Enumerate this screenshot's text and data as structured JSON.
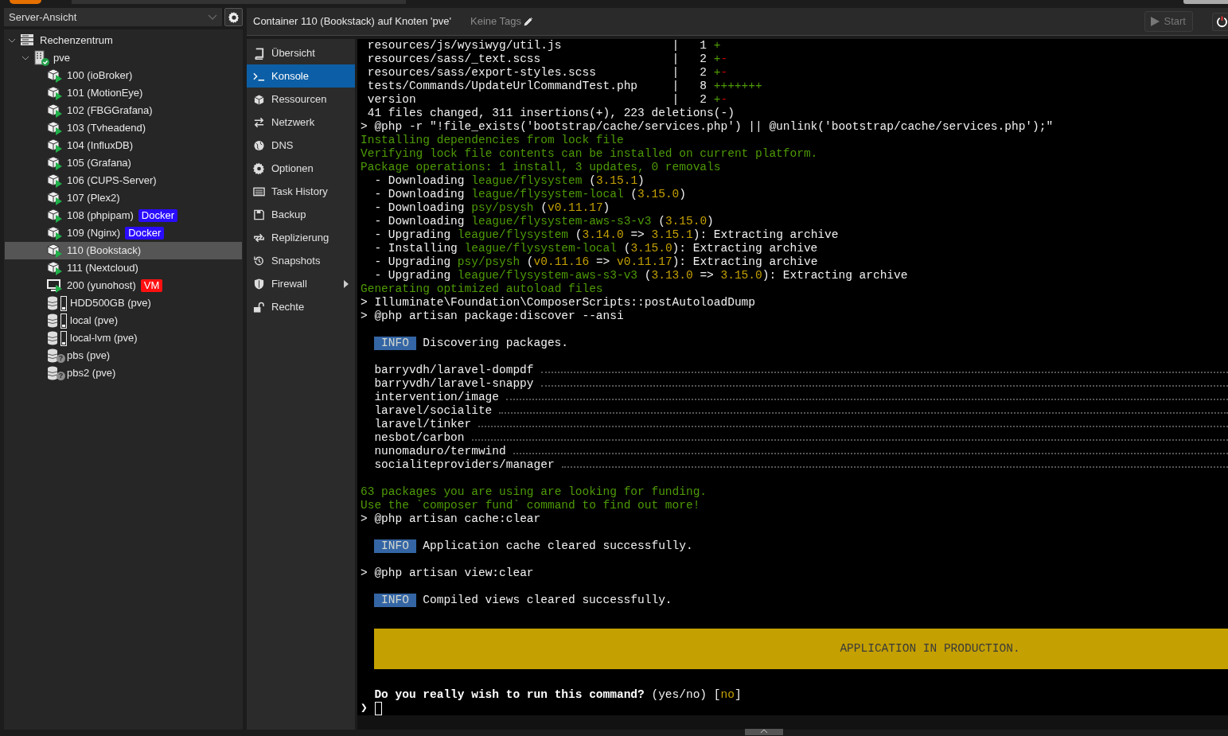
{
  "view_selector": {
    "value": "Server-Ansicht"
  },
  "tree": [
    {
      "kind": "datacenter",
      "label": "Rechenzentrum",
      "expanded": true,
      "selected": false,
      "children": [
        {
          "kind": "node",
          "label": "pve",
          "online": true,
          "expanded": true,
          "selected": false,
          "children": [
            {
              "kind": "container",
              "label": "100 (ioBroker)",
              "running": true,
              "selected": false
            },
            {
              "kind": "container",
              "label": "101 (MotionEye)",
              "running": true,
              "selected": false
            },
            {
              "kind": "container",
              "label": "102 (FBGGrafana)",
              "running": true,
              "selected": false
            },
            {
              "kind": "container",
              "label": "103 (Tvheadend)",
              "running": true,
              "selected": false
            },
            {
              "kind": "container",
              "label": "104 (InfluxDB)",
              "running": true,
              "selected": false
            },
            {
              "kind": "container",
              "label": "105 (Grafana)",
              "running": true,
              "selected": false
            },
            {
              "kind": "container",
              "label": "106 (CUPS-Server)",
              "running": true,
              "selected": false
            },
            {
              "kind": "container",
              "label": "107 (Plex2)",
              "running": true,
              "selected": false
            },
            {
              "kind": "container",
              "label": "108 (phpipam)",
              "running": true,
              "selected": false,
              "tags": [
                {
                  "text": "Docker",
                  "color": "#2a0cff"
                }
              ]
            },
            {
              "kind": "container",
              "label": "109 (Nginx)",
              "running": true,
              "selected": false,
              "tags": [
                {
                  "text": "Docker",
                  "color": "#2a0cff"
                }
              ]
            },
            {
              "kind": "container",
              "label": "110 (Bookstack)",
              "running": true,
              "selected": true
            },
            {
              "kind": "container",
              "label": "111 (Nextcloud)",
              "running": true,
              "selected": false
            },
            {
              "kind": "vm",
              "label": "200 (yunohost)",
              "running": true,
              "selected": false,
              "tags": [
                {
                  "text": "VM",
                  "color": "#ff1010"
                }
              ]
            },
            {
              "kind": "storage",
              "label": "HDD500GB (pve)",
              "selected": false
            },
            {
              "kind": "storage",
              "label": "local (pve)",
              "selected": false
            },
            {
              "kind": "storage",
              "label": "local-lvm (pve)",
              "selected": false
            },
            {
              "kind": "pbs",
              "label": "pbs (pve)",
              "status_symbol": "?",
              "selected": false
            },
            {
              "kind": "pbs",
              "label": "pbs2 (pve)",
              "status_symbol": "?",
              "selected": false
            }
          ]
        }
      ]
    }
  ],
  "header": {
    "title": "Container 110 (Bookstack) auf Knoten 'pve'",
    "tags_label": "Keine Tags",
    "start_button": {
      "label": "Start",
      "disabled": true
    }
  },
  "menu": [
    {
      "label": "Übersicht",
      "selected": false
    },
    {
      "label": "Konsole",
      "selected": true
    },
    {
      "label": "Ressourcen",
      "selected": false
    },
    {
      "label": "Netzwerk",
      "selected": false
    },
    {
      "label": "DNS",
      "selected": false
    },
    {
      "label": "Optionen",
      "selected": false
    },
    {
      "label": "Task History",
      "selected": false
    },
    {
      "label": "Backup",
      "selected": false
    },
    {
      "label": "Replizierung",
      "selected": false
    },
    {
      "label": "Snapshots",
      "selected": false
    },
    {
      "label": "Firewall",
      "selected": false,
      "has_submenu": true
    },
    {
      "label": "Rechte",
      "selected": false
    }
  ],
  "terminal": [
    {
      "kind": "diffstat",
      "file": "resources/js/wysiwyg/util.js",
      "separator": "|",
      "count": "1",
      "added": "+"
    },
    {
      "kind": "diffstat",
      "file": "resources/sass/_text.scss",
      "separator": "|",
      "count": "2",
      "added": "+",
      "removed": "-"
    },
    {
      "kind": "diffstat",
      "file": "resources/sass/export-styles.scss",
      "separator": "|",
      "count": "2",
      "added": "+",
      "removed": "-"
    },
    {
      "kind": "diffstat",
      "file": "tests/Commands/UpdateUrlCommandTest.php",
      "separator": "|",
      "count": "8",
      "added": "+++++++"
    },
    {
      "kind": "diffstat",
      "file": "version",
      "separator": "|",
      "count": "2",
      "added": "+",
      "removed": "-"
    },
    {
      "kind": "text",
      "segments": [
        {
          "text": " 41 files changed, 311 insertions(+), 223 deletions(-)",
          "kind": "plain"
        }
      ]
    },
    {
      "kind": "text",
      "segments": [
        {
          "text": "> @php -r \"!file_exists('bootstrap/cache/services.php') || @unlink('bootstrap/cache/services.php');\"",
          "kind": "plain"
        }
      ]
    },
    {
      "kind": "text",
      "segments": [
        {
          "text": "Installing dependencies from lock file",
          "kind": "green"
        }
      ]
    },
    {
      "kind": "text",
      "segments": [
        {
          "text": "Verifying lock file contents can be installed on current platform.",
          "kind": "green"
        }
      ]
    },
    {
      "kind": "text",
      "segments": [
        {
          "text": "Package operations: 1 install, 3 updates, 0 removals",
          "kind": "green"
        }
      ]
    },
    {
      "kind": "text",
      "segments": [
        {
          "text": "  - Downloading ",
          "kind": "plain"
        },
        {
          "text": "league/flysystem",
          "kind": "green"
        },
        {
          "text": " (",
          "kind": "plain"
        },
        {
          "text": "3.15.1",
          "kind": "yellow"
        },
        {
          "text": ")",
          "kind": "plain"
        }
      ]
    },
    {
      "kind": "text",
      "segments": [
        {
          "text": "  - Downloading ",
          "kind": "plain"
        },
        {
          "text": "league/flysystem-local",
          "kind": "green"
        },
        {
          "text": " (",
          "kind": "plain"
        },
        {
          "text": "3.15.0",
          "kind": "yellow"
        },
        {
          "text": ")",
          "kind": "plain"
        }
      ]
    },
    {
      "kind": "text",
      "segments": [
        {
          "text": "  - Downloading ",
          "kind": "plain"
        },
        {
          "text": "psy/psysh",
          "kind": "green"
        },
        {
          "text": " (",
          "kind": "plain"
        },
        {
          "text": "v0.11.17",
          "kind": "yellow"
        },
        {
          "text": ")",
          "kind": "plain"
        }
      ]
    },
    {
      "kind": "text",
      "segments": [
        {
          "text": "  - Downloading ",
          "kind": "plain"
        },
        {
          "text": "league/flysystem-aws-s3-v3",
          "kind": "green"
        },
        {
          "text": " (",
          "kind": "plain"
        },
        {
          "text": "3.15.0",
          "kind": "yellow"
        },
        {
          "text": ")",
          "kind": "plain"
        }
      ]
    },
    {
      "kind": "text",
      "segments": [
        {
          "text": "  - Upgrading ",
          "kind": "plain"
        },
        {
          "text": "league/flysystem",
          "kind": "green"
        },
        {
          "text": " (",
          "kind": "plain"
        },
        {
          "text": "3.14.0",
          "kind": "yellow"
        },
        {
          "text": " => ",
          "kind": "plain"
        },
        {
          "text": "3.15.1",
          "kind": "yellow"
        },
        {
          "text": "): Extracting archive",
          "kind": "plain"
        }
      ]
    },
    {
      "kind": "text",
      "segments": [
        {
          "text": "  - Installing ",
          "kind": "plain"
        },
        {
          "text": "league/flysystem-local",
          "kind": "green"
        },
        {
          "text": " (",
          "kind": "plain"
        },
        {
          "text": "3.15.0",
          "kind": "yellow"
        },
        {
          "text": "): Extracting archive",
          "kind": "plain"
        }
      ]
    },
    {
      "kind": "text",
      "segments": [
        {
          "text": "  - Upgrading ",
          "kind": "plain"
        },
        {
          "text": "psy/psysh",
          "kind": "green"
        },
        {
          "text": " (",
          "kind": "plain"
        },
        {
          "text": "v0.11.16",
          "kind": "yellow"
        },
        {
          "text": " => ",
          "kind": "plain"
        },
        {
          "text": "v0.11.17",
          "kind": "yellow"
        },
        {
          "text": "): Extracting archive",
          "kind": "plain"
        }
      ]
    },
    {
      "kind": "text",
      "segments": [
        {
          "text": "  - Upgrading ",
          "kind": "plain"
        },
        {
          "text": "league/flysystem-aws-s3-v3",
          "kind": "green"
        },
        {
          "text": " (",
          "kind": "plain"
        },
        {
          "text": "3.13.0",
          "kind": "yellow"
        },
        {
          "text": " => ",
          "kind": "plain"
        },
        {
          "text": "3.15.0",
          "kind": "yellow"
        },
        {
          "text": "): Extracting archive",
          "kind": "plain"
        }
      ]
    },
    {
      "kind": "text",
      "segments": [
        {
          "text": "Generating optimized autoload files",
          "kind": "green"
        }
      ]
    },
    {
      "kind": "text",
      "segments": [
        {
          "text": "> Illuminate\\Foundation\\ComposerScripts::postAutoloadDump",
          "kind": "plain"
        }
      ]
    },
    {
      "kind": "text",
      "segments": [
        {
          "text": "> @php artisan package:discover --ansi",
          "kind": "plain"
        }
      ]
    },
    {
      "kind": "blank"
    },
    {
      "kind": "indented",
      "segments": [
        {
          "text": "INFO",
          "kind": "info"
        },
        {
          "text": " Discovering packages.",
          "kind": "plain"
        }
      ]
    },
    {
      "kind": "blank"
    },
    {
      "kind": "package",
      "segments": [
        {
          "text": "barryvdh/laravel-dompdf",
          "kind": "plain"
        }
      ]
    },
    {
      "kind": "package",
      "segments": [
        {
          "text": "barryvdh/laravel-snappy",
          "kind": "plain"
        }
      ]
    },
    {
      "kind": "package",
      "segments": [
        {
          "text": "intervention/image",
          "kind": "plain"
        }
      ]
    },
    {
      "kind": "package",
      "segments": [
        {
          "text": "laravel/socialite",
          "kind": "plain"
        }
      ]
    },
    {
      "kind": "package",
      "segments": [
        {
          "text": "laravel/tinker",
          "kind": "plain"
        }
      ]
    },
    {
      "kind": "package",
      "segments": [
        {
          "text": "nesbot/carbon",
          "kind": "plain"
        }
      ]
    },
    {
      "kind": "package",
      "segments": [
        {
          "text": "nunomaduro/termwind",
          "kind": "plain"
        }
      ]
    },
    {
      "kind": "package",
      "segments": [
        {
          "text": "socialiteproviders/manager",
          "kind": "plain"
        }
      ]
    },
    {
      "kind": "blank"
    },
    {
      "kind": "text",
      "segments": [
        {
          "text": "63 packages you are using are looking for funding.",
          "kind": "green"
        }
      ]
    },
    {
      "kind": "text",
      "segments": [
        {
          "text": "Use the `composer fund` command to find out more!",
          "kind": "green"
        }
      ]
    },
    {
      "kind": "text",
      "segments": [
        {
          "text": "> @php artisan cache:clear",
          "kind": "plain"
        }
      ]
    },
    {
      "kind": "blank"
    },
    {
      "kind": "indented",
      "segments": [
        {
          "text": "INFO",
          "kind": "info"
        },
        {
          "text": " Application cache cleared successfully.",
          "kind": "plain"
        }
      ]
    },
    {
      "kind": "blank"
    },
    {
      "kind": "text",
      "segments": [
        {
          "text": "> @php artisan view:clear",
          "kind": "plain"
        }
      ]
    },
    {
      "kind": "blank"
    },
    {
      "kind": "indented",
      "segments": [
        {
          "text": "INFO",
          "kind": "info"
        },
        {
          "text": " Compiled views cleared successfully.",
          "kind": "plain"
        }
      ]
    },
    {
      "kind": "blank"
    },
    {
      "kind": "blank"
    },
    {
      "kind": "banner",
      "text": "APPLICATION IN PRODUCTION."
    },
    {
      "kind": "blank"
    },
    {
      "kind": "indented",
      "segments": [
        {
          "text": "Do you really wish to run this command?",
          "kind": "bold"
        },
        {
          "text": " (yes/no) [",
          "kind": "plain"
        },
        {
          "text": "no",
          "kind": "yellow"
        },
        {
          "text": "]",
          "kind": "plain"
        }
      ]
    },
    {
      "kind": "prompt",
      "segments": [
        {
          "text": "❯",
          "kind": "bold"
        }
      ]
    }
  ]
}
